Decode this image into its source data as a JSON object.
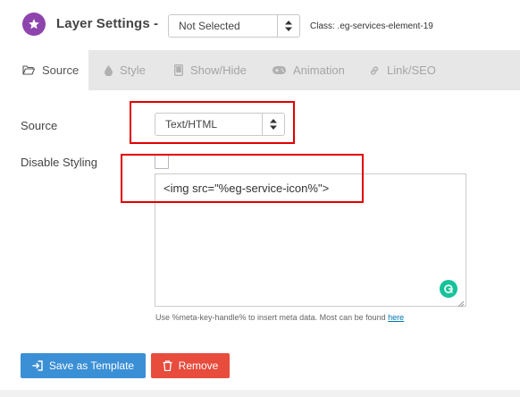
{
  "header": {
    "title": "Layer Settings -",
    "icon": "star-icon",
    "layer_select_value": "Not Selected",
    "class_label": "Class: .eg-services-element-19"
  },
  "tabs": [
    {
      "label": "Source",
      "icon": "folder-icon",
      "active": true
    },
    {
      "label": "Style",
      "icon": "droplet-icon",
      "active": false
    },
    {
      "label": "Show/Hide",
      "icon": "tablet-icon",
      "active": false
    },
    {
      "label": "Animation",
      "icon": "gamepad-icon",
      "active": false
    },
    {
      "label": "Link/SEO",
      "icon": "link-icon",
      "active": false
    }
  ],
  "source": {
    "label": "Source",
    "select_value": "Text/HTML"
  },
  "disable_styling": {
    "label": "Disable Styling",
    "checked": false
  },
  "editor": {
    "content": "<img src=\"%eg-service-icon%\">"
  },
  "hint": {
    "text": "Use %meta-key-handle% to insert meta data. Most can be found ",
    "link": "here"
  },
  "buttons": {
    "save_template": "Save as Template",
    "remove": "Remove"
  },
  "colors": {
    "accent_purple": "#8e44ad",
    "highlight_red": "#e00000",
    "button_blue": "#3b8fd5",
    "button_red": "#e74c3c",
    "grammarly_green": "#15c39a"
  }
}
